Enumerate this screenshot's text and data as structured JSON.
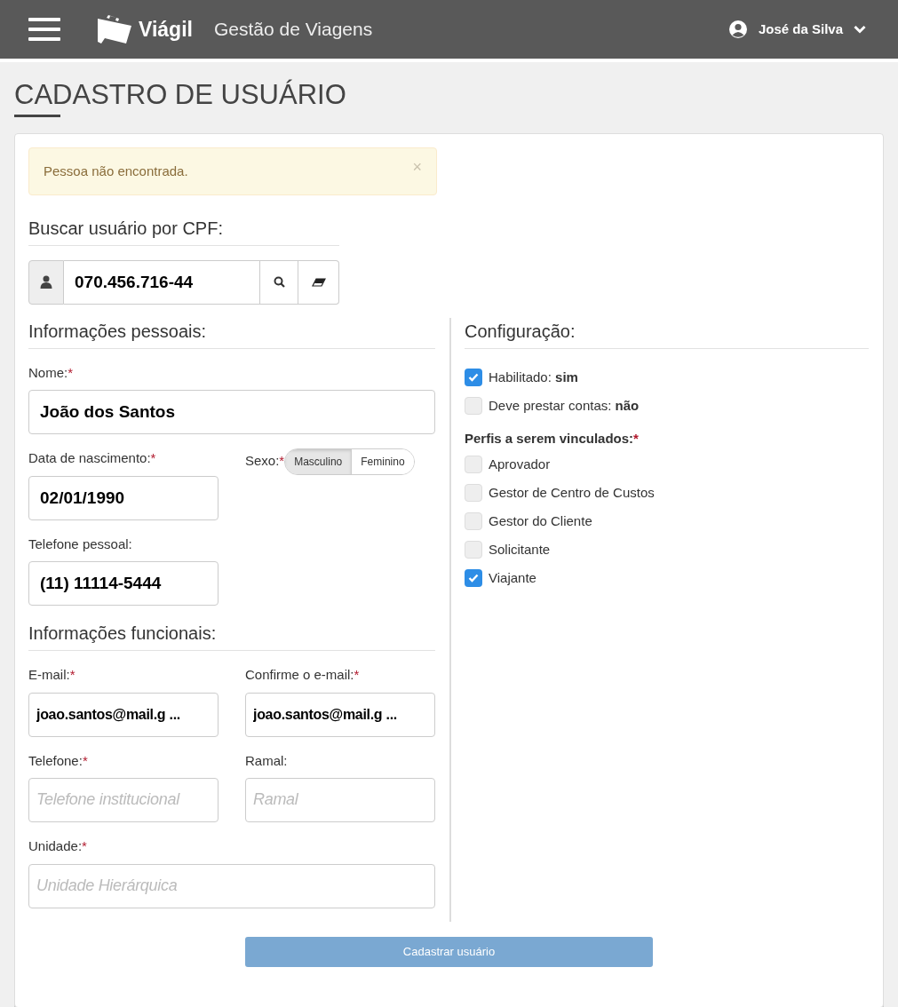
{
  "header": {
    "brand": "Viágil",
    "subtitle": "Gestão de Viagens",
    "user": "José da Silva"
  },
  "page_title": "CADASTRO DE USUÁRIO",
  "alert": {
    "text": "Pessoa não encontrada.",
    "close": "×"
  },
  "search": {
    "title": "Buscar usuário por CPF:",
    "value": "070.456.716-44"
  },
  "personal": {
    "title": "Informações pessoais:",
    "name": {
      "label": "Nome:",
      "mark": "*",
      "value": "João dos Santos"
    },
    "birth": {
      "label": "Data de nascimento:",
      "mark": "*",
      "value": "02/01/1990"
    },
    "sex": {
      "label": "Sexo:",
      "mark": "*",
      "options": [
        {
          "label": "Masculino",
          "selected": true
        },
        {
          "label": "Feminino",
          "selected": false
        }
      ]
    },
    "phone": {
      "label": "Telefone pessoal:",
      "value": "(11) 11114-5444"
    }
  },
  "functional": {
    "title": "Informações funcionais:",
    "fields": [
      {
        "label": "E-mail:",
        "mark": "*",
        "value": "joao.santos@mail.g ..."
      },
      {
        "label": "Confirme o e-mail:",
        "mark": "*",
        "value": "joao.santos@mail.g ..."
      },
      {
        "label": "Telefone:",
        "mark": "*",
        "placeholder": "Telefone institucional"
      },
      {
        "label": "Ramal:",
        "placeholder": "Ramal"
      },
      {
        "label": "Unidade:",
        "mark": "*",
        "placeholder": "Unidade Hierárquica"
      }
    ]
  },
  "config": {
    "title": "Configuração:",
    "options": [
      {
        "label": "Habilitado: **sim**",
        "checked": true
      },
      {
        "label": "Deve prestar contas: **não**",
        "checked": false
      }
    ],
    "profiles_title": {
      "label": "Perfis a serem vinculados:",
      "mark": "*"
    },
    "profiles": [
      {
        "label": "Aprovador",
        "checked": false
      },
      {
        "label": "Gestor de Centro de Custos",
        "checked": false
      },
      {
        "label": "Gestor do Cliente",
        "checked": false
      },
      {
        "label": "Solicitante",
        "checked": false
      },
      {
        "label": "Viajante",
        "checked": true
      }
    ]
  },
  "submit": {
    "label": "Cadastrar usuário",
    "disabled": true
  }
}
